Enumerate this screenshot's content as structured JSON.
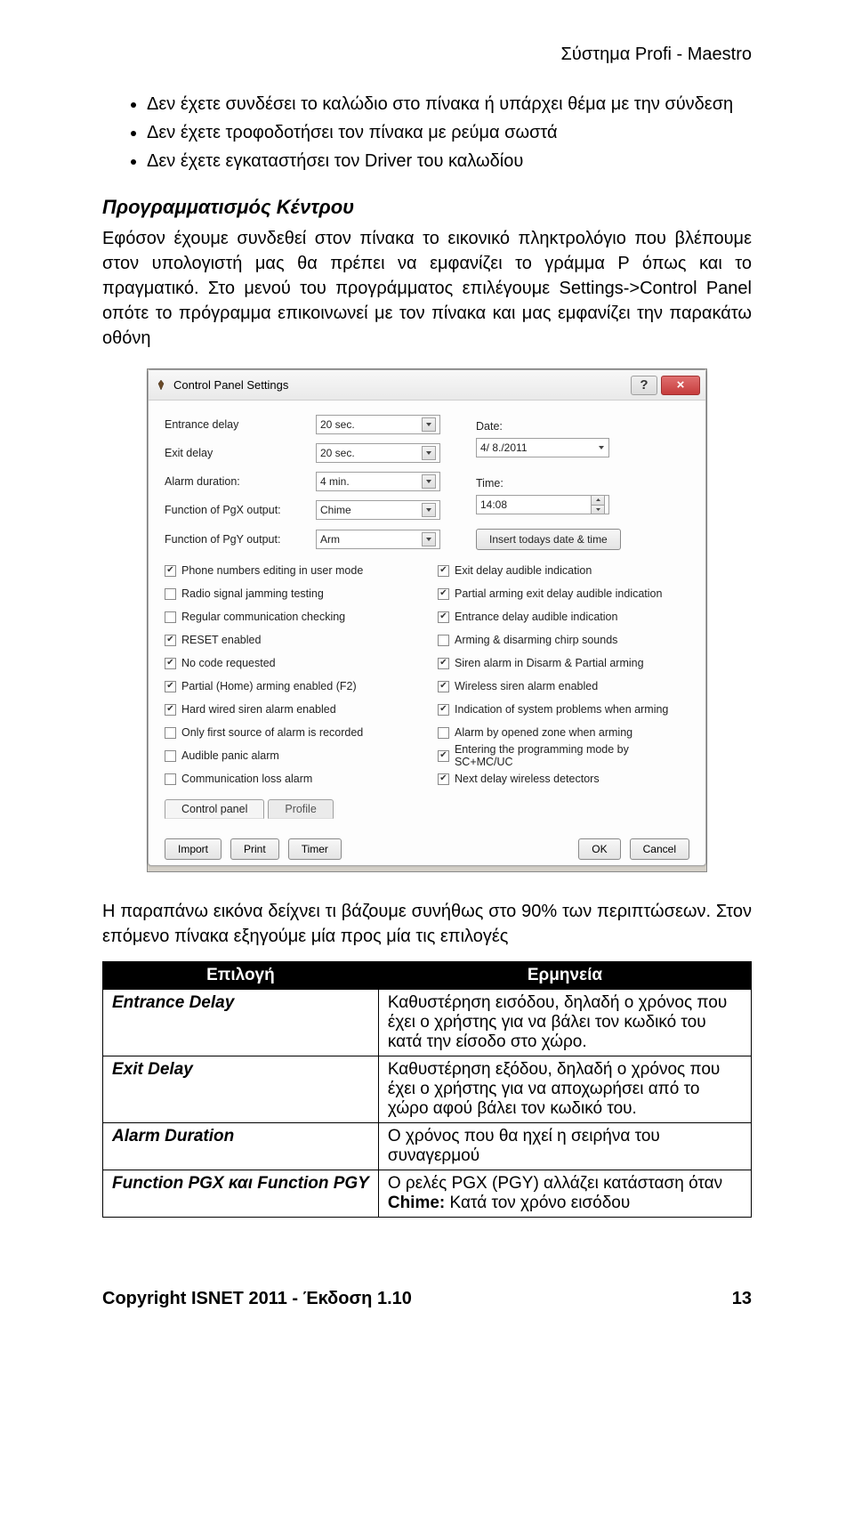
{
  "header": {
    "right": "Σύστημα Profi - Maestro"
  },
  "bullets": [
    "Δεν έχετε συνδέσει το καλώδιο στο πίνακα ή υπάρχει θέμα με την σύνδεση",
    "Δεν έχετε τροφοδοτήσει τον πίνακα με ρεύμα σωστά",
    "Δεν έχετε εγκαταστήσει τον Driver του καλωδίου"
  ],
  "section": {
    "title": "Προγραμματισμός Κέντρου",
    "body": "Εφόσον έχουμε συνδεθεί στον πίνακα το εικονικό πληκτρολόγιο που βλέπουμε στον υπολογιστή μας θα πρέπει να εμφανίζει το γράμμα P όπως και το πραγματικό. Στο μενού του προγράμματος επιλέγουμε Settings->Control Panel οπότε το πρόγραμμα επικοινωνεί με τον πίνακα και μας εμφανίζει την παρακάτω οθόνη"
  },
  "dialog": {
    "title": "Control Panel Settings",
    "help_char": "?",
    "close_char": "×",
    "form": {
      "entrance_delay_label": "Entrance delay",
      "entrance_delay_value": "20 sec.",
      "exit_delay_label": "Exit delay",
      "exit_delay_value": "20 sec.",
      "alarm_duration_label": "Alarm duration:",
      "alarm_duration_value": "4 min.",
      "pgx_label": "Function of PgX output:",
      "pgx_value": "Chime",
      "pgy_label": "Function of PgY output:",
      "pgy_value": "Arm",
      "date_label": "Date:",
      "date_value": "4/ 8./2011",
      "time_label": "Time:",
      "time_value": "14:08",
      "insert_btn": "Insert todays date & time"
    },
    "checks_left": [
      {
        "label": "Phone numbers editing in user mode",
        "checked": true
      },
      {
        "label": "Radio signal jamming testing",
        "checked": false
      },
      {
        "label": "Regular communication checking",
        "checked": false
      },
      {
        "label": "RESET enabled",
        "checked": true
      },
      {
        "label": "No code requested",
        "checked": true
      },
      {
        "label": "Partial (Home) arming enabled (F2)",
        "checked": true
      },
      {
        "label": "Hard wired siren alarm enabled",
        "checked": true
      },
      {
        "label": "Only first source of alarm is recorded",
        "checked": false
      },
      {
        "label": "Audible panic alarm",
        "checked": false
      },
      {
        "label": "Communication loss alarm",
        "checked": false
      }
    ],
    "checks_right": [
      {
        "label": "Exit delay audible indication",
        "checked": true
      },
      {
        "label": "Partial arming exit delay audible indication",
        "checked": true
      },
      {
        "label": "Entrance delay audible indication",
        "checked": true
      },
      {
        "label": "Arming & disarming chirp sounds",
        "checked": false
      },
      {
        "label": "Siren alarm in Disarm & Partial arming",
        "checked": true
      },
      {
        "label": "Wireless siren alarm enabled",
        "checked": true
      },
      {
        "label": "Indication of system problems when arming",
        "checked": true
      },
      {
        "label": "Alarm by opened zone when arming",
        "checked": false
      },
      {
        "label": "Entering the programming mode by SC+MC/UC",
        "checked": true
      },
      {
        "label": "Next delay wireless detectors",
        "checked": true
      }
    ],
    "tabs": {
      "control_panel": "Control panel",
      "profile": "Profile"
    },
    "buttons": {
      "import": "Import",
      "print": "Print",
      "timer": "Timer",
      "ok": "OK",
      "cancel": "Cancel"
    }
  },
  "caption": "Η παραπάνω εικόνα δείχνει τι βάζουμε συνήθως στο 90% των περιπτώσεων. Στον επόμενο πίνακα εξηγούμε μία προς μία τις επιλογές",
  "table": {
    "head_option": "Επιλογή",
    "head_meaning": "Ερμηνεία",
    "rows": [
      {
        "opt": "Entrance Delay",
        "meaning": "Καθυστέρηση εισόδου, δηλαδή ο χρόνος που έχει ο χρήστης για να βάλει τον κωδικό του κατά την είσοδο στο χώρο."
      },
      {
        "opt": "Exit Delay",
        "meaning": "Καθυστέρηση εξόδου, δηλαδή ο χρόνος που έχει ο χρήστης για να αποχωρήσει από το χώρο αφού βάλει τον κωδικό του."
      },
      {
        "opt": "Alarm Duration",
        "meaning": "Ο χρόνος που θα ηχεί η σειρήνα του συναγερμού"
      },
      {
        "opt": "Function PGX και Function PGY",
        "meaning": "Ο ρελές PGX (PGY) αλλάζει κατάσταση όταν\nChime: Κατά τον χρόνο εισόδου"
      }
    ]
  },
  "footer": {
    "left": "Copyright ISNET 2011 - Έκδοση 1.10",
    "right": "13"
  }
}
